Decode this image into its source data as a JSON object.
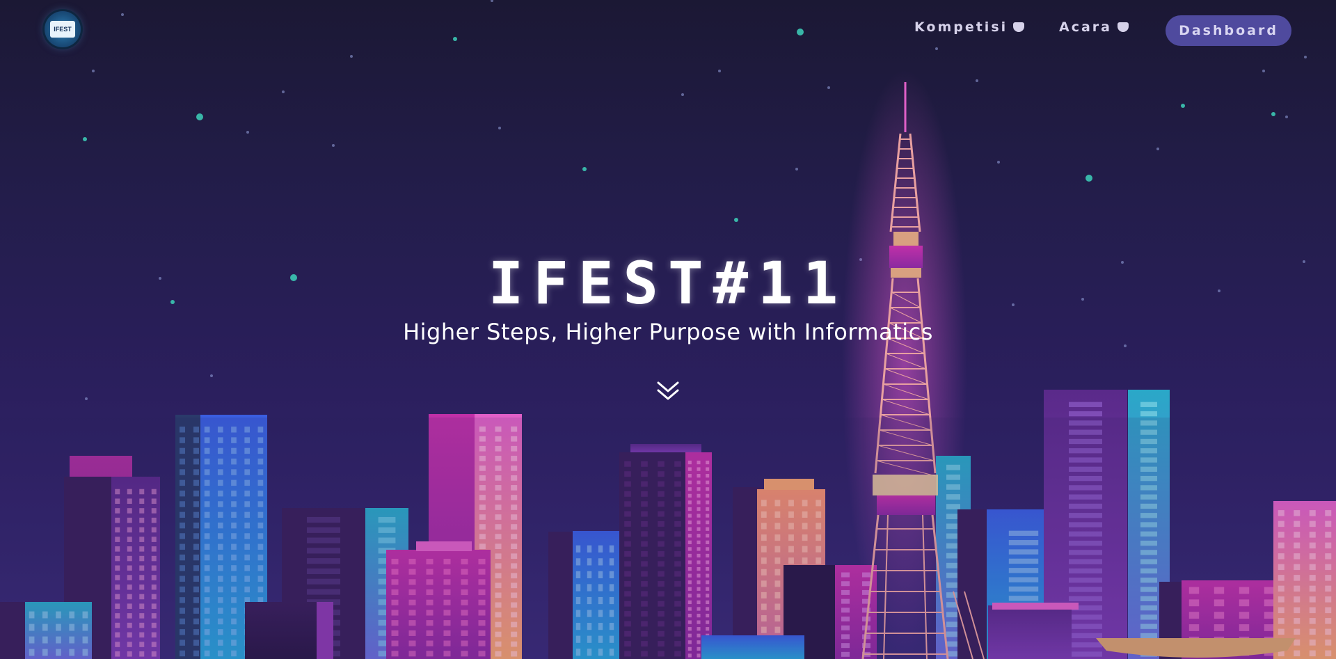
{
  "nav": {
    "logo_text": "IFEST",
    "items": [
      {
        "label": "Kompetisi"
      },
      {
        "label": "Acara"
      }
    ],
    "dashboard_label": "Dashboard"
  },
  "hero": {
    "title": "IFEST#11",
    "subtitle": "Higher Steps, Higher Purpose with Informatics"
  },
  "colors": {
    "accent_button": "#4f4a9e",
    "star": "#3cc8b4",
    "neon_pink": "#e040c8",
    "neon_blue": "#3a8de0"
  },
  "icons": [
    "logo-icon",
    "caret-down-icon",
    "double-chevron-down-icon"
  ]
}
